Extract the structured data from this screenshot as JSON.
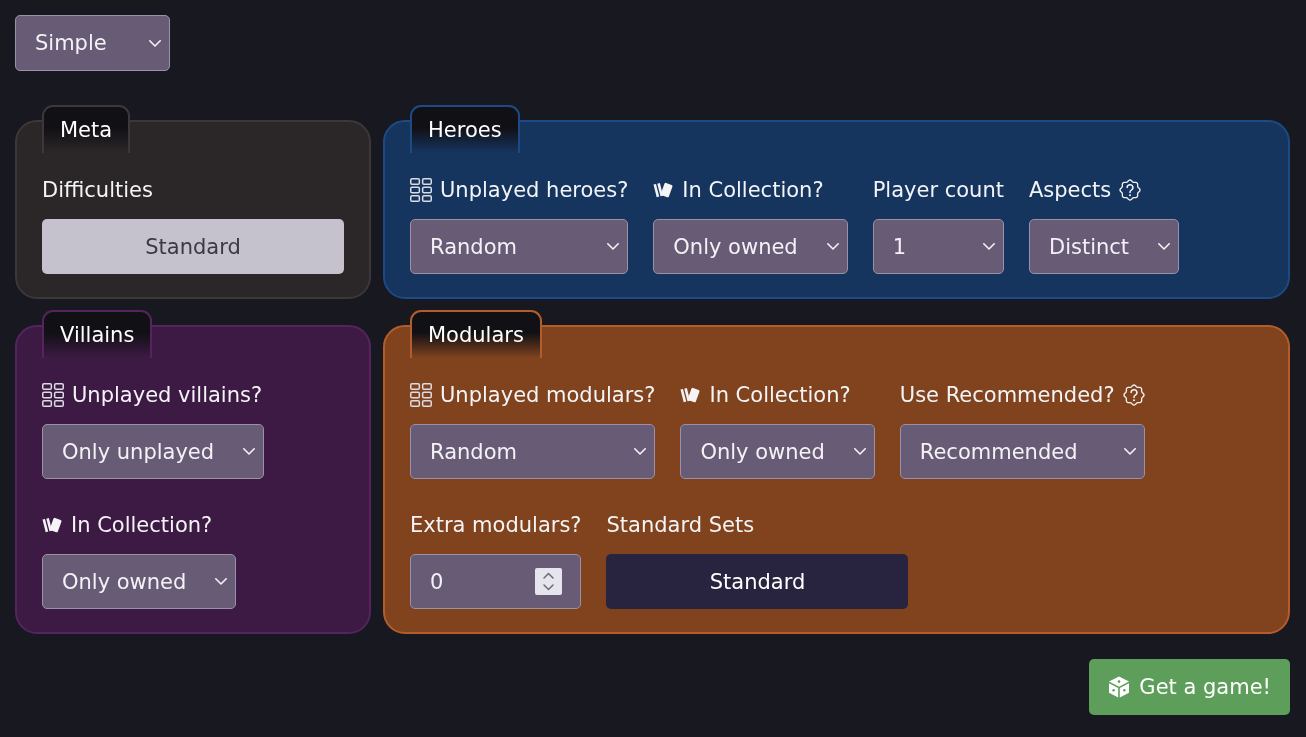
{
  "mode_select": {
    "value": "Simple"
  },
  "panels": [
    {
      "title": "Meta",
      "color": "#2b2729",
      "rows": [
        {
          "fields": [
            {
              "kind": "button",
              "label": {
                "text": "Difficulties",
                "kind": "plain"
              },
              "value": "Standard",
              "selected": true
            }
          ]
        }
      ]
    },
    {
      "title": "Heroes",
      "color": "#15355f",
      "rows": [
        {
          "fields": [
            {
              "kind": "select",
              "label": {
                "text": "Unplayed heroes?",
                "kind": "played"
              },
              "value": "Random"
            },
            {
              "kind": "select",
              "label": {
                "text": "In Collection?",
                "kind": "owned"
              },
              "value": "Only owned"
            },
            {
              "kind": "select",
              "label": {
                "text": "Player count",
                "kind": "plain"
              },
              "value": "1"
            },
            {
              "kind": "select",
              "label": {
                "text": "Aspects",
                "kind": "hint"
              },
              "value": "Distinct"
            }
          ]
        }
      ]
    },
    {
      "title": "Villains",
      "color": "#3d1a44",
      "rows": [
        {
          "fields": [
            {
              "kind": "select",
              "label": {
                "text": "Unplayed villains?",
                "kind": "played"
              },
              "value": "Only unplayed"
            }
          ]
        },
        {
          "fields": [
            {
              "kind": "select",
              "label": {
                "text": "In Collection?",
                "kind": "owned"
              },
              "value": "Only owned"
            }
          ]
        }
      ]
    },
    {
      "title": "Modulars",
      "color": "#80431e",
      "rows": [
        {
          "fields": [
            {
              "kind": "select",
              "label": {
                "text": "Unplayed modulars?",
                "kind": "played"
              },
              "value": "Random"
            },
            {
              "kind": "select",
              "label": {
                "text": "In Collection?",
                "kind": "owned"
              },
              "value": "Only owned"
            },
            {
              "kind": "select",
              "label": {
                "text": "Use Recommended?",
                "kind": "hint"
              },
              "value": "Recommended"
            }
          ]
        },
        {
          "fields": [
            {
              "kind": "number",
              "label": {
                "text": "Extra modulars?",
                "kind": "plain"
              },
              "value": "0"
            },
            {
              "kind": "button",
              "label": {
                "text": "Standard Sets",
                "kind": "plain"
              },
              "value": "Standard",
              "selected": false
            }
          ]
        }
      ]
    }
  ],
  "submit_button": {
    "label": "Get a game!"
  }
}
